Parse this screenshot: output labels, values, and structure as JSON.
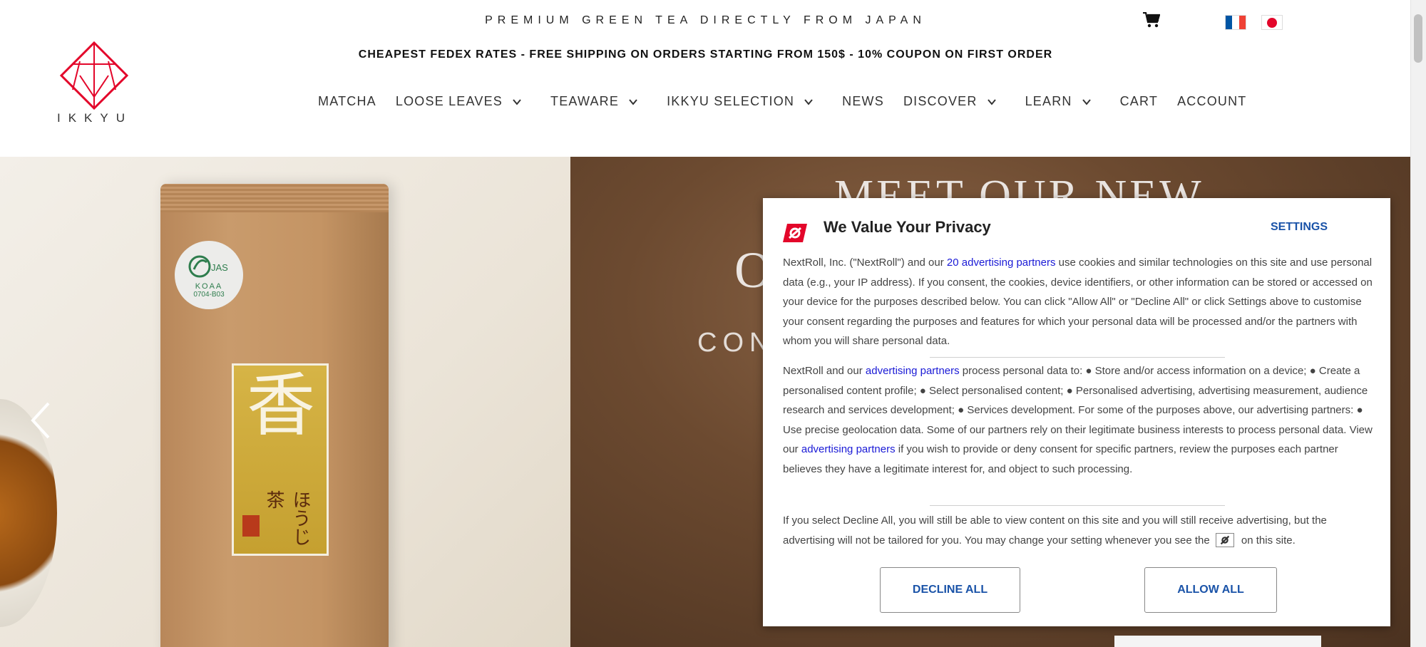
{
  "header": {
    "tagline": "PREMIUM GREEN TEA DIRECTLY FROM JAPAN",
    "shipping_banner": "CHEAPEST FEDEX RATES - FREE SHIPPING ON ORDERS STARTING FROM 150$ - 10% COUPON ON FIRST ORDER",
    "logo_text": "IKKYU",
    "cart_icon": "cart-icon",
    "flags": [
      "flag-fr",
      "flag-jp"
    ]
  },
  "nav": {
    "items": [
      {
        "label": "MATCHA",
        "dropdown": false
      },
      {
        "label": "LOOSE LEAVES",
        "dropdown": true
      },
      {
        "label": "TEAWARE",
        "dropdown": true
      },
      {
        "label": "IKKYU SELECTION",
        "dropdown": true
      },
      {
        "label": "NEWS",
        "dropdown": false
      },
      {
        "label": "DISCOVER",
        "dropdown": true
      },
      {
        "label": "LEARN",
        "dropdown": true
      },
      {
        "label": "CART",
        "dropdown": false
      },
      {
        "label": "ACCOUNT",
        "dropdown": false
      }
    ]
  },
  "hero": {
    "title": "MEET OUR NEW",
    "title_line2": "O",
    "subtitle": "CON",
    "bag": {
      "seal_koaa": "KOAA",
      "seal_number": "0704-B03",
      "seal_jas": "JAS",
      "label_char": "香",
      "label_sub": "ほうじ茶"
    }
  },
  "consent": {
    "title": "We Value Your Privacy",
    "settings": "SETTINGS",
    "p1": {
      "before": "NextRoll, Inc. (\"NextRoll\") and our ",
      "link": "20 advertising partners",
      "after": " use cookies and similar technologies on this site and use personal data (e.g., your IP address). If you consent, the cookies, device identifiers, or other information can be stored or accessed on your device for the purposes described below. You can click \"Allow All\" or \"Decline All\" or click Settings above to customise your consent regarding the purposes and features for which your personal data will be processed and/or the partners with whom you will share personal data."
    },
    "p2": {
      "before": "NextRoll and our ",
      "link1": "advertising partners",
      "middle": " process personal data to: ● Store and/or access information on a device; ● Create a personalised content profile; ● Select personalised content; ● Personalised advertising, advertising measurement, audience research and services development; ● Services development. For some of the purposes above, our advertising partners: ● Use precise geolocation data. Some of our partners rely on their legitimate business interests to process personal data. View our ",
      "link2": "advertising partners",
      "after": " if you wish to provide or deny consent for specific partners, review the purposes each partner believes they have a legitimate interest for, and object to such processing."
    },
    "p3": {
      "before": "If you select Decline All, you will still be able to view content on this site and you will still receive advertising, but the advertising will not be tailored for you. You may change your setting whenever you see the",
      "after": "on this site."
    },
    "decline": "DECLINE ALL",
    "allow": "ALLOW ALL"
  },
  "colors": {
    "brand_red": "#e3062a",
    "link_blue": "#1a1ad6",
    "button_blue": "#1a53a8"
  }
}
